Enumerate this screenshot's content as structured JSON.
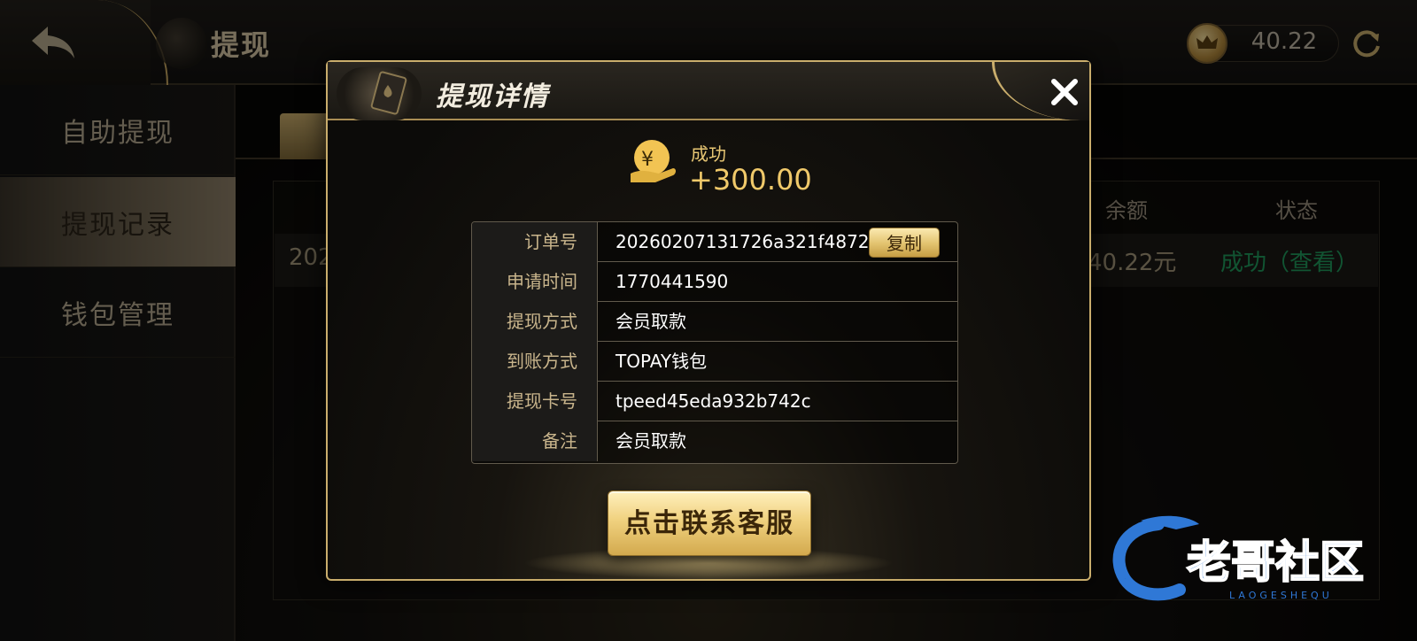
{
  "header": {
    "title": "提现",
    "balance": "40.22"
  },
  "sidebar": {
    "items": [
      {
        "label": "自助提现"
      },
      {
        "label": "提现记录"
      },
      {
        "label": "钱包管理"
      }
    ]
  },
  "table": {
    "headers": [
      "余额",
      "状态"
    ],
    "row": {
      "date_partial": "202",
      "balance": "40.22元",
      "status": "成功（查看）"
    }
  },
  "modal": {
    "title": "提现详情",
    "status": "成功",
    "amount": "+300.00",
    "rows": [
      {
        "label": "订单号",
        "value": "20260207131726a321f4872e..."
      },
      {
        "label": "申请时间",
        "value": "1770441590"
      },
      {
        "label": "提现方式",
        "value": "会员取款"
      },
      {
        "label": "到账方式",
        "value": "TOPAY钱包"
      },
      {
        "label": "提现卡号",
        "value": "tpeed45eda932b742c"
      },
      {
        "label": "备注",
        "value": "会员取款"
      }
    ],
    "copy_label": "复制",
    "contact_button": "点击联系客服"
  },
  "watermark": {
    "text": "老哥社区",
    "subtext": "LAOGESHEQU"
  },
  "colors": {
    "gold": "#c9ad6c",
    "success_green": "#1f9a5c",
    "amount_gold": "#f0c96a"
  }
}
